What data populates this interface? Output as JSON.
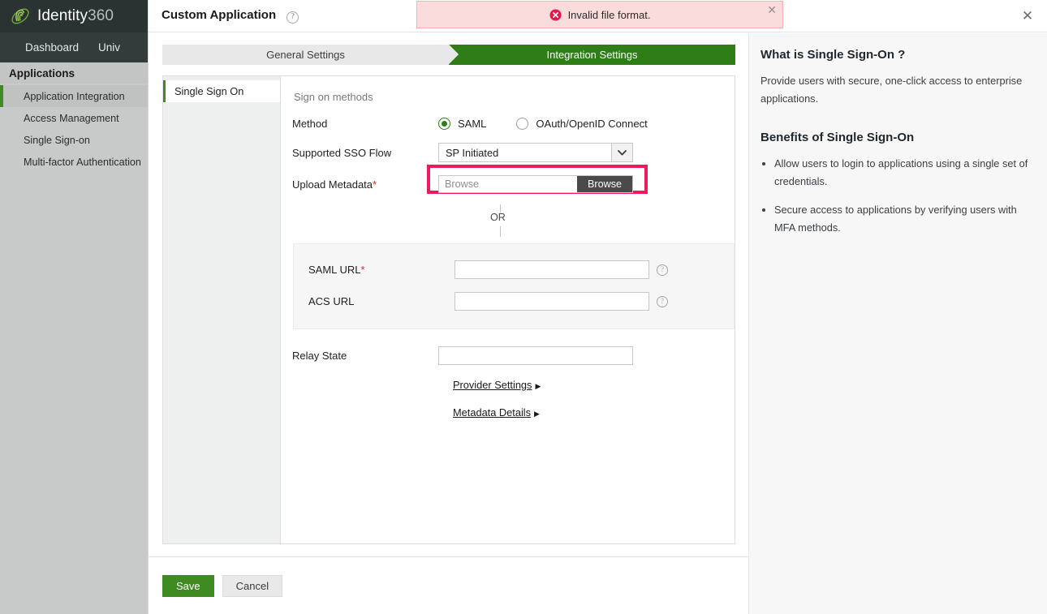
{
  "app": {
    "brand_primary": "Identity",
    "brand_secondary": "360",
    "logo_icon": "fingerprint-orbit-logo",
    "topnav": [
      {
        "label": "Dashboard"
      },
      {
        "label": "Univ"
      }
    ],
    "sidebar": {
      "section_title": "Applications",
      "items": [
        {
          "label": "Application Integration",
          "active": true
        },
        {
          "label": "Access Management",
          "active": false
        },
        {
          "label": "Single Sign-on",
          "active": false
        },
        {
          "label": "Multi-factor Authentication",
          "active": false
        }
      ]
    }
  },
  "colors": {
    "accent_green": "#3f8a21",
    "tab_active_green": "#2e7d16",
    "highlight_pink": "#ef1a5c",
    "error_bg": "#fadcdc",
    "error_border": "#f0b3b3",
    "required_red": "#d6232e"
  },
  "modal": {
    "title": "Custom Application",
    "title_help_icon": "question-circle-icon",
    "close_icon": "close-icon"
  },
  "error": {
    "icon": "error-circle-x-icon",
    "message": "Invalid file format.",
    "close_icon": "close-icon"
  },
  "steps": [
    {
      "label": "General Settings",
      "active": false
    },
    {
      "label": "Integration Settings",
      "active": true
    }
  ],
  "panel_nav": [
    {
      "label": "Single Sign On",
      "active": true
    }
  ],
  "form": {
    "section_heading": "Sign on methods",
    "method": {
      "label": "Method",
      "options": [
        {
          "label": "SAML",
          "selected": true
        },
        {
          "label": "OAuth/OpenID Connect",
          "selected": false
        }
      ]
    },
    "sso_flow": {
      "label": "Supported SSO Flow",
      "value": "SP Initiated",
      "dropdown_icon": "chevron-down-icon"
    },
    "upload_metadata": {
      "label": "Upload Metadata",
      "required_marker": "*",
      "placeholder": "Browse",
      "button_label": "Browse",
      "highlighted": true
    },
    "or_divider": "OR",
    "saml_url": {
      "label": "SAML URL",
      "required_marker": "*",
      "value": "",
      "hint_icon": "question-circle-icon"
    },
    "acs_url": {
      "label": "ACS URL",
      "value": "",
      "hint_icon": "question-circle-icon"
    },
    "relay_state": {
      "label": "Relay State",
      "value": ""
    },
    "links": [
      {
        "label": "Provider Settings",
        "expander_icon": "triangle-right-icon"
      },
      {
        "label": "Metadata Details",
        "expander_icon": "triangle-right-icon"
      }
    ]
  },
  "footer": {
    "save_label": "Save",
    "cancel_label": "Cancel"
  },
  "help": {
    "heading": "What is Single Sign-On ?",
    "paragraph": "Provide users with secure, one-click access to enterprise applications.",
    "benefits_heading": "Benefits of Single Sign-On",
    "benefits": [
      "Allow users to login to applications using a single set of credentials.",
      "Secure access to applications by verifying users with MFA methods."
    ]
  }
}
